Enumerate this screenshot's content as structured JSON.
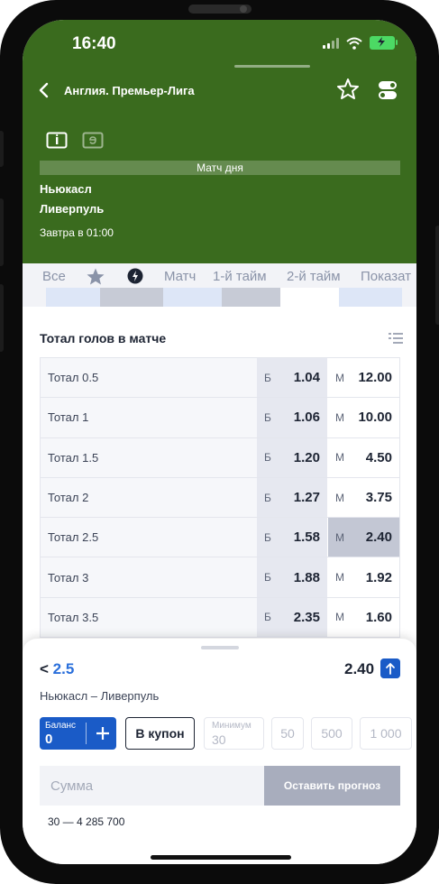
{
  "status_bar": {
    "time": "16:40"
  },
  "header": {
    "league": "Англия. Премьер-Лига",
    "match_of_day": "Матч дня",
    "team_home": "Ньюкасл",
    "team_away": "Ливерпуль",
    "start_time": "Завтра в 01:00"
  },
  "tabs": [
    {
      "label": "Все"
    },
    {
      "label": "Матч"
    },
    {
      "label": "1-й тайм"
    },
    {
      "label": "2-й тайм"
    },
    {
      "label": "Показат"
    }
  ],
  "market": {
    "title": "Тотал голов в матче",
    "over_label": "Б",
    "under_label": "М",
    "rows": [
      {
        "name": "Тотал 0.5",
        "over": "1.04",
        "under": "12.00"
      },
      {
        "name": "Тотал 1",
        "over": "1.06",
        "under": "10.00"
      },
      {
        "name": "Тотал 1.5",
        "over": "1.20",
        "under": "4.50"
      },
      {
        "name": "Тотал 2",
        "over": "1.27",
        "under": "3.75"
      },
      {
        "name": "Тотал 2.5",
        "over": "1.58",
        "under": "2.40",
        "selected": "under"
      },
      {
        "name": "Тотал 3",
        "over": "1.88",
        "under": "1.92"
      },
      {
        "name": "Тотал 3.5",
        "over": "2.35",
        "under": "1.60"
      }
    ]
  },
  "bet_slip": {
    "selection_prefix": "<",
    "selection_value": "2.5",
    "odd": "2.40",
    "match": "Ньюкасл – Ливерпуль",
    "balance_label": "Баланс",
    "balance_value": "0",
    "coupon_label": "В купон",
    "min_label": "Минимум",
    "min_value": "30",
    "quick_amounts": [
      "50",
      "500",
      "1 000"
    ],
    "amount_placeholder": "Сумма",
    "submit_label": "Оставить прогноз",
    "range": "30 — 4 285 700"
  },
  "colors": {
    "header_bg": "#3a6b1e",
    "accent": "#1a5bc7",
    "selected_cell": "#c3c7d4"
  }
}
